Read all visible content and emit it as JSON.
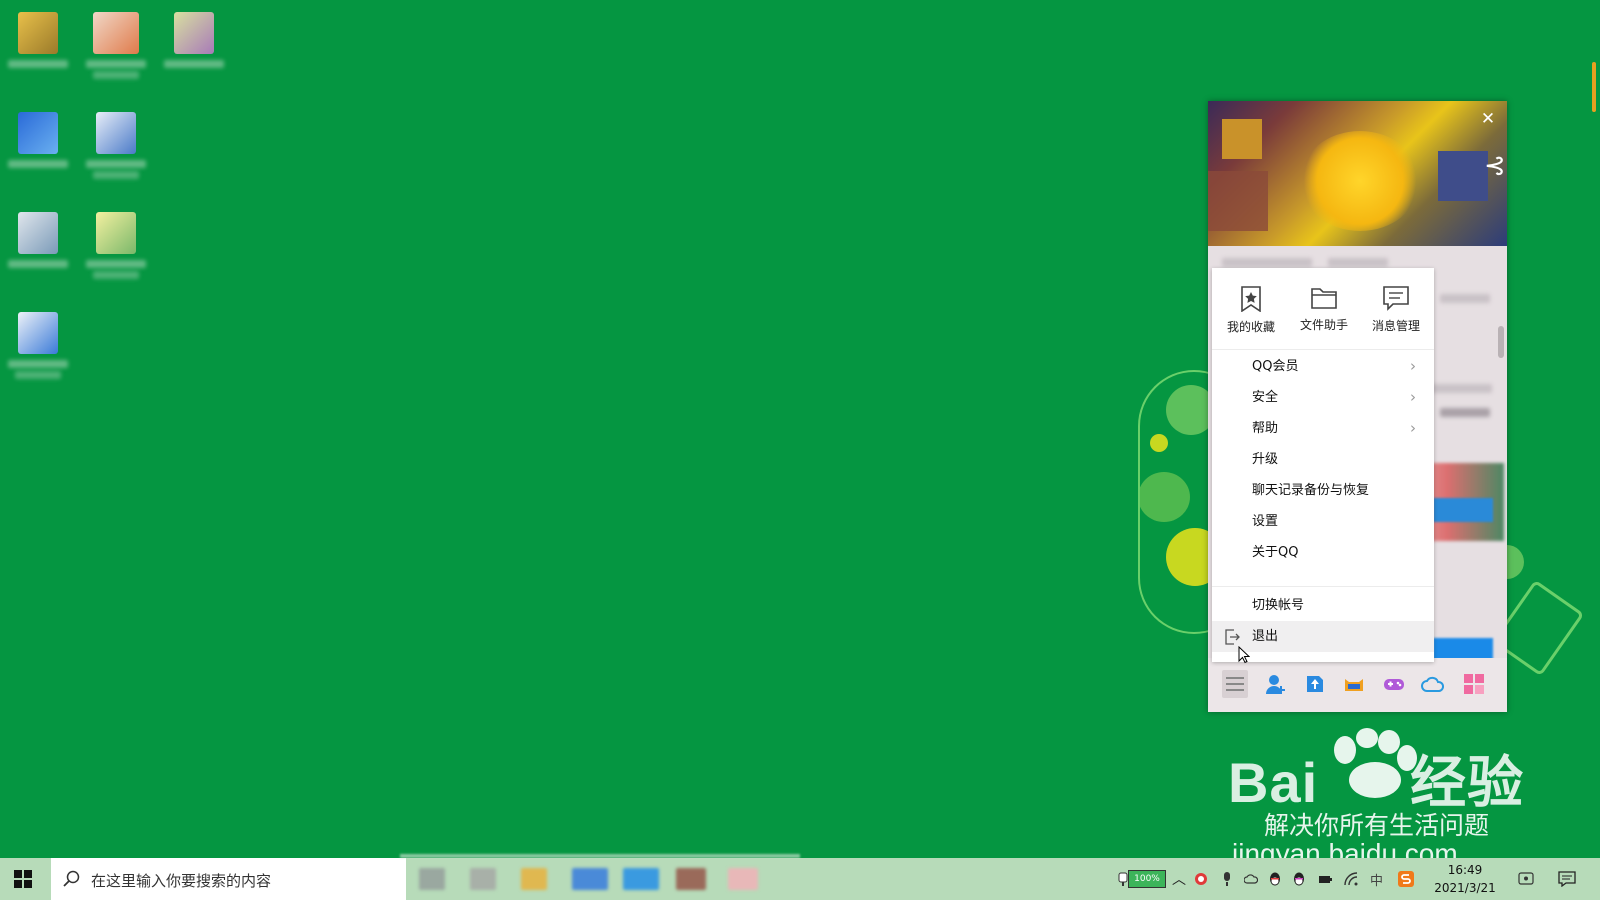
{
  "desktop": {
    "background_color": "#059641",
    "icons": [
      {
        "name": "desktop-icon-1",
        "color": "#d9b24a"
      },
      {
        "name": "desktop-icon-2",
        "color": "#e8a47a"
      },
      {
        "name": "desktop-icon-3",
        "color": "#b8c890"
      },
      {
        "name": "desktop-icon-4",
        "color": "#3a8ad8"
      },
      {
        "name": "desktop-icon-5",
        "color": "#c8d8e8"
      },
      {
        "name": "desktop-icon-6",
        "color": "#c8d0d8"
      },
      {
        "name": "desktop-icon-7",
        "color": "#e0e080"
      },
      {
        "name": "desktop-icon-8",
        "color": "#d8e4f0"
      }
    ]
  },
  "qq_menu": {
    "quick_actions": [
      {
        "label": "我的收藏",
        "icon": "star-bookmark-icon"
      },
      {
        "label": "文件助手",
        "icon": "folder-icon"
      },
      {
        "label": "消息管理",
        "icon": "message-icon"
      }
    ],
    "items": [
      {
        "label": "QQ会员",
        "has_submenu": true
      },
      {
        "label": "安全",
        "has_submenu": true
      },
      {
        "label": "帮助",
        "has_submenu": true
      },
      {
        "label": "升级",
        "has_submenu": false
      },
      {
        "label": "聊天记录备份与恢复",
        "has_submenu": false
      },
      {
        "label": "设置",
        "has_submenu": false
      },
      {
        "label": "关于QQ",
        "has_submenu": false
      }
    ],
    "account_items": [
      {
        "label": "切换帐号"
      },
      {
        "label": "退出",
        "icon": "logout-icon",
        "highlighted": true
      }
    ]
  },
  "qq_bottom_bar": {
    "icons": [
      "main-menu-icon",
      "add-contact-icon",
      "file-transfer-icon",
      "cat-app-icon",
      "game-icon",
      "weiyun-cloud-icon",
      "app-manager-icon"
    ]
  },
  "watermark": {
    "brand": "Bai",
    "brand2": "经验",
    "slogan": "解决你所有生活问题",
    "url": "jingyan.baidu.com"
  },
  "taskbar": {
    "search_placeholder": "在这里输入你要搜索的内容",
    "battery": "100%",
    "ime": "中",
    "time": "16:49",
    "date": "2021/3/21"
  }
}
